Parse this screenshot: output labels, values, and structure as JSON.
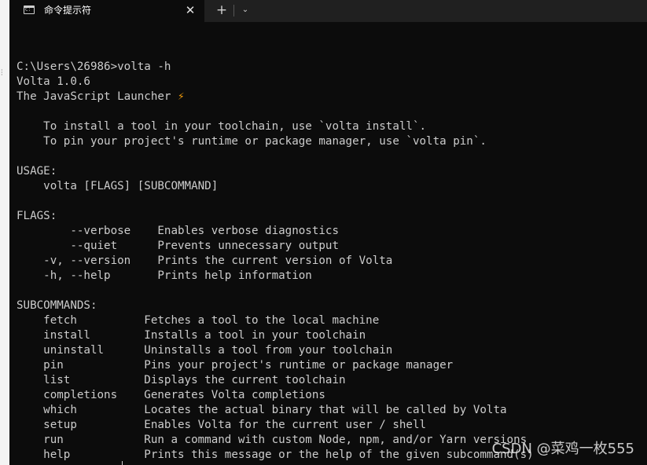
{
  "window": {
    "tab_title": "命令提示符",
    "tab_icon": "terminal-icon",
    "close_glyph": "✕",
    "new_tab_glyph": "+",
    "dropdown_glyph": "⌄"
  },
  "terminal": {
    "lines": [
      "",
      "C:\\Users\\26986>volta -h",
      "Volta 1.0.6",
      "The JavaScript Launcher ",
      "",
      "    To install a tool in your toolchain, use `volta install`.",
      "    To pin your project's runtime or package manager, use `volta pin`.",
      "",
      "USAGE:",
      "    volta [FLAGS] [SUBCOMMAND]",
      "",
      "FLAGS:",
      "        --verbose    Enables verbose diagnostics",
      "        --quiet      Prevents unnecessary output",
      "    -v, --version    Prints the current version of Volta",
      "    -h, --help       Prints help information",
      "",
      "SUBCOMMANDS:",
      "    fetch          Fetches a tool to the local machine",
      "    install        Installs a tool in your toolchain",
      "    uninstall      Uninstalls a tool from your toolchain",
      "    pin            Pins your project's runtime or package manager",
      "    list           Displays the current toolchain",
      "    completions    Generates Volta completions",
      "    which          Locates the actual binary that will be called by Volta",
      "    setup          Enables Volta for the current user / shell",
      "    run            Run a command with custom Node, npm, and/or Yarn versions",
      "    help           Prints this message or the help of the given subcommand(s)"
    ],
    "launcher_emoji": "⚡"
  },
  "watermark": "CSDN @菜鸡一枚555",
  "colors": {
    "background": "#0c0c0c",
    "text": "#cccccc",
    "titlebar": "#202020",
    "bolt": "#f59e0b"
  }
}
